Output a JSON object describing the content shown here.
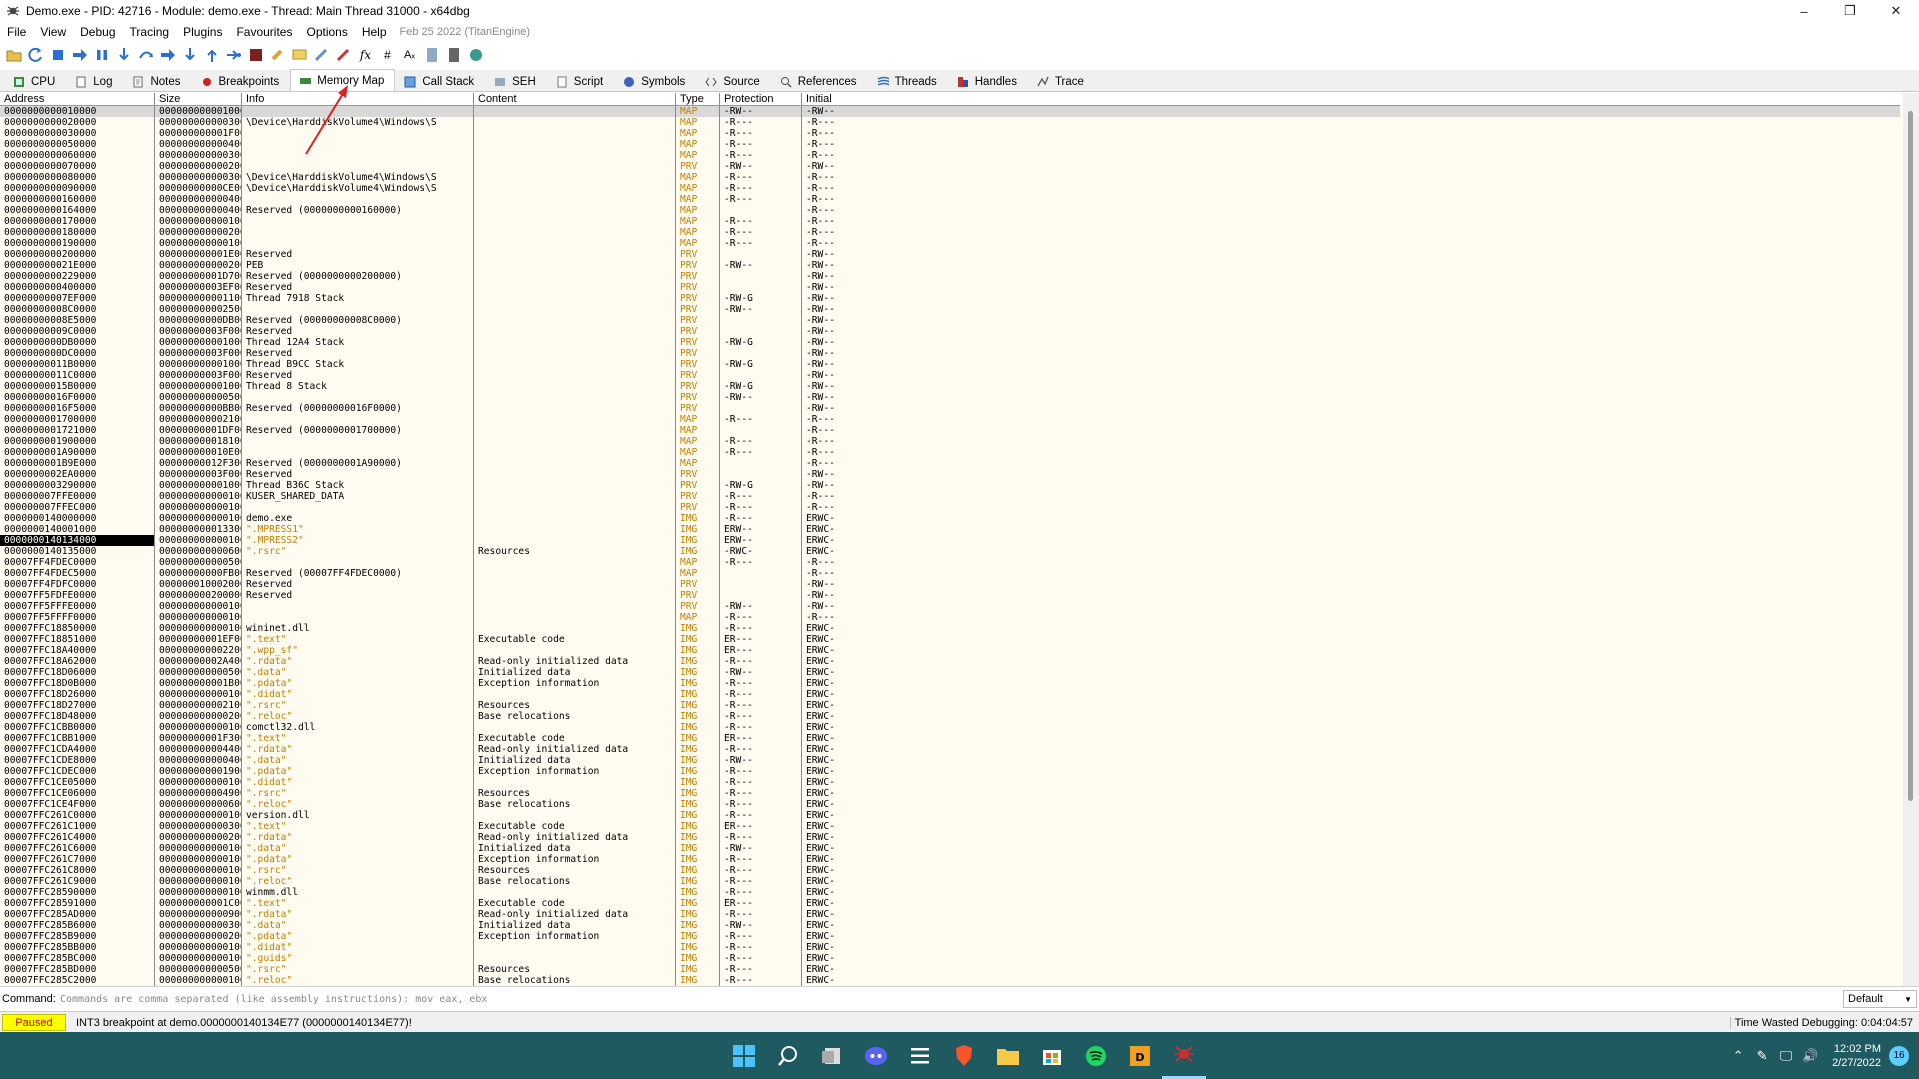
{
  "window": {
    "title": "Demo.exe - PID: 42716 - Module: demo.exe - Thread: Main Thread 31000 - x64dbg",
    "minimize_icon": "minimize-icon",
    "maximize_icon": "restore-icon",
    "close_icon": "close-icon"
  },
  "menu": {
    "items": [
      "File",
      "View",
      "Debug",
      "Tracing",
      "Plugins",
      "Favourites",
      "Options",
      "Help"
    ],
    "build": "Feb 25 2022 (TitanEngine)"
  },
  "tabs": [
    {
      "label": "CPU",
      "icon": "cpu-icon"
    },
    {
      "label": "Log",
      "icon": "log-icon"
    },
    {
      "label": "Notes",
      "icon": "notes-icon"
    },
    {
      "label": "Breakpoints",
      "icon": "breakpoint-icon"
    },
    {
      "label": "Memory Map",
      "icon": "memory-icon",
      "active": true
    },
    {
      "label": "Call Stack",
      "icon": "callstack-icon"
    },
    {
      "label": "SEH",
      "icon": "seh-icon"
    },
    {
      "label": "Script",
      "icon": "script-icon"
    },
    {
      "label": "Symbols",
      "icon": "symbols-icon"
    },
    {
      "label": "Source",
      "icon": "source-icon"
    },
    {
      "label": "References",
      "icon": "references-icon"
    },
    {
      "label": "Threads",
      "icon": "threads-icon"
    },
    {
      "label": "Handles",
      "icon": "handles-icon"
    },
    {
      "label": "Trace",
      "icon": "trace-icon"
    }
  ],
  "columns": [
    "Address",
    "Size",
    "Info",
    "Content",
    "Type",
    "Protection",
    "Initial"
  ],
  "rows": [
    [
      "0000000000010000",
      "0000000000010000",
      "",
      "",
      "MAP",
      "-RW--",
      "-RW--"
    ],
    [
      "0000000000020000",
      "0000000000003000",
      "\\Device\\HarddiskVolume4\\Windows\\S",
      "",
      "MAP",
      "-R---",
      "-R---"
    ],
    [
      "0000000000030000",
      "000000000001F000",
      "",
      "",
      "MAP",
      "-R---",
      "-R---"
    ],
    [
      "0000000000050000",
      "0000000000004000",
      "",
      "",
      "MAP",
      "-R---",
      "-R---"
    ],
    [
      "0000000000060000",
      "0000000000003000",
      "",
      "",
      "MAP",
      "-R---",
      "-R---"
    ],
    [
      "0000000000070000",
      "0000000000002000",
      "",
      "",
      "PRV",
      "-RW--",
      "-RW--"
    ],
    [
      "0000000000080000",
      "0000000000003000",
      "\\Device\\HarddiskVolume4\\Windows\\S",
      "",
      "MAP",
      "-R---",
      "-R---"
    ],
    [
      "0000000000090000",
      "00000000000CE000",
      "\\Device\\HarddiskVolume4\\Windows\\S",
      "",
      "MAP",
      "-R---",
      "-R---"
    ],
    [
      "0000000000160000",
      "0000000000004000",
      "",
      "",
      "MAP",
      "-R---",
      "-R---"
    ],
    [
      "0000000000164000",
      "0000000000004000",
      "Reserved (0000000000160000)",
      "",
      "MAP",
      "",
      "-R---"
    ],
    [
      "0000000000170000",
      "0000000000001000",
      "",
      "",
      "MAP",
      "-R---",
      "-R---"
    ],
    [
      "0000000000180000",
      "0000000000002000",
      "",
      "",
      "MAP",
      "-R---",
      "-R---"
    ],
    [
      "0000000000190000",
      "0000000000001000",
      "",
      "",
      "MAP",
      "-R---",
      "-R---"
    ],
    [
      "0000000000200000",
      "000000000001E000",
      "Reserved",
      "",
      "PRV",
      "",
      "-RW--"
    ],
    [
      "000000000021E000",
      "0000000000002000",
      "PEB",
      "",
      "PRV",
      "-RW--",
      "-RW--"
    ],
    [
      "0000000000229000",
      "00000000001D7000",
      "Reserved (0000000000200000)",
      "",
      "PRV",
      "",
      "-RW--"
    ],
    [
      "0000000000400000",
      "00000000003EF000",
      "Reserved",
      "",
      "PRV",
      "",
      "-RW--"
    ],
    [
      "00000000007EF000",
      "0000000000011000",
      "Thread 7918 Stack",
      "",
      "PRV",
      "-RW-G",
      "-RW--"
    ],
    [
      "00000000008C0000",
      "0000000000025000",
      "",
      "",
      "PRV",
      "-RW--",
      "-RW--"
    ],
    [
      "00000000008E5000",
      "00000000000DB000",
      "Reserved (00000000008C0000)",
      "",
      "PRV",
      "",
      "-RW--"
    ],
    [
      "00000000009C0000",
      "00000000003F0000",
      "Reserved",
      "",
      "PRV",
      "",
      "-RW--"
    ],
    [
      "0000000000DB0000",
      "0000000000010000",
      "Thread 12A4 Stack",
      "",
      "PRV",
      "-RW-G",
      "-RW--"
    ],
    [
      "0000000000DC0000",
      "00000000003F0000",
      "Reserved",
      "",
      "PRV",
      "",
      "-RW--"
    ],
    [
      "00000000011B0000",
      "0000000000010000",
      "Thread B9CC Stack",
      "",
      "PRV",
      "-RW-G",
      "-RW--"
    ],
    [
      "00000000011C0000",
      "00000000003F0000",
      "Reserved",
      "",
      "PRV",
      "",
      "-RW--"
    ],
    [
      "00000000015B0000",
      "0000000000010000",
      "Thread 8 Stack",
      "",
      "PRV",
      "-RW-G",
      "-RW--"
    ],
    [
      "00000000016F0000",
      "0000000000005000",
      "",
      "",
      "PRV",
      "-RW--",
      "-RW--"
    ],
    [
      "00000000016F5000",
      "00000000000BB000",
      "Reserved (00000000016F0000)",
      "",
      "PRV",
      "",
      "-RW--"
    ],
    [
      "0000000001700000",
      "0000000000021000",
      "",
      "",
      "MAP",
      "-R---",
      "-R---"
    ],
    [
      "0000000001721000",
      "00000000001DF000",
      "Reserved (0000000001700000)",
      "",
      "MAP",
      "",
      "-R---"
    ],
    [
      "0000000001900000",
      "0000000000181000",
      "",
      "",
      "MAP",
      "-R---",
      "-R---"
    ],
    [
      "0000000001A90000",
      "000000000010E000",
      "",
      "",
      "MAP",
      "-R---",
      "-R---"
    ],
    [
      "0000000001B9E000",
      "00000000012F3000",
      "Reserved (0000000001A90000)",
      "",
      "MAP",
      "",
      "-R---"
    ],
    [
      "0000000002EA0000",
      "00000000003F0000",
      "Reserved",
      "",
      "PRV",
      "",
      "-RW--"
    ],
    [
      "0000000003290000",
      "0000000000010000",
      "Thread B36C Stack",
      "",
      "PRV",
      "-RW-G",
      "-RW--"
    ],
    [
      "000000007FFE0000",
      "0000000000001000",
      "KUSER_SHARED_DATA",
      "",
      "PRV",
      "-R---",
      "-R---"
    ],
    [
      "000000007FFEC000",
      "0000000000001000",
      "",
      "",
      "PRV",
      "-R---",
      "-R---"
    ],
    [
      "0000000140000000",
      "0000000000001000",
      "demo.exe",
      "",
      "IMG",
      "-R---",
      "ERWC-"
    ],
    [
      "0000000140001000",
      "0000000000133000",
      "\".MPRESS1\"",
      "",
      "IMG",
      "ERW--",
      "ERWC-"
    ],
    [
      "0000000140134000",
      "0000000000001000",
      "\".MPRESS2\"",
      "",
      "IMG",
      "ERW--",
      "ERWC-"
    ],
    [
      "0000000140135000",
      "0000000000006000",
      "\".rsrc\"",
      "Resources",
      "IMG",
      "-RWC-",
      "ERWC-"
    ],
    [
      "00007FF4FDEC0000",
      "0000000000005000",
      "",
      "",
      "MAP",
      "-R---",
      "-R---"
    ],
    [
      "00007FF4FDEC5000",
      "00000000000FB000",
      "Reserved (00007FF4FDEC0000)",
      "",
      "MAP",
      "",
      "-R---"
    ],
    [
      "00007FF4FDFC0000",
      "0000000100020000",
      "Reserved",
      "",
      "PRV",
      "",
      "-RW--"
    ],
    [
      "00007FF5FDFE0000",
      "0000000002000000",
      "Reserved",
      "",
      "PRV",
      "",
      "-RW--"
    ],
    [
      "00007FF5FFFE0000",
      "0000000000001000",
      "",
      "",
      "PRV",
      "-RW--",
      "-RW--"
    ],
    [
      "00007FF5FFFF0000",
      "0000000000001000",
      "",
      "",
      "MAP",
      "-R---",
      "-R---"
    ],
    [
      "00007FFC18850000",
      "0000000000001000",
      "wininet.dll",
      "",
      "IMG",
      "-R---",
      "ERWC-"
    ],
    [
      "00007FFC18851000",
      "00000000001EF000",
      "\".text\"",
      "Executable code",
      "IMG",
      "ER---",
      "ERWC-"
    ],
    [
      "00007FFC18A40000",
      "0000000000022000",
      "\".wpp_sf\"",
      "",
      "IMG",
      "ER---",
      "ERWC-"
    ],
    [
      "00007FFC18A62000",
      "00000000002A4000",
      "\".rdata\"",
      "Read-only initialized data",
      "IMG",
      "-R---",
      "ERWC-"
    ],
    [
      "00007FFC18D06000",
      "0000000000005000",
      "\".data\"",
      "Initialized data",
      "IMG",
      "-RW--",
      "ERWC-"
    ],
    [
      "00007FFC18D0B000",
      "000000000001B000",
      "\".pdata\"",
      "Exception information",
      "IMG",
      "-R---",
      "ERWC-"
    ],
    [
      "00007FFC18D26000",
      "0000000000001000",
      "\".didat\"",
      "",
      "IMG",
      "-R---",
      "ERWC-"
    ],
    [
      "00007FFC18D27000",
      "0000000000021000",
      "\".rsrc\"",
      "Resources",
      "IMG",
      "-R---",
      "ERWC-"
    ],
    [
      "00007FFC18D48000",
      "0000000000002000",
      "\".reloc\"",
      "Base relocations",
      "IMG",
      "-R---",
      "ERWC-"
    ],
    [
      "00007FFC1CBB0000",
      "0000000000001000",
      "comctl32.dll",
      "",
      "IMG",
      "-R---",
      "ERWC-"
    ],
    [
      "00007FFC1CBB1000",
      "00000000001F3000",
      "\".text\"",
      "Executable code",
      "IMG",
      "ER---",
      "ERWC-"
    ],
    [
      "00007FFC1CDA4000",
      "0000000000044000",
      "\".rdata\"",
      "Read-only initialized data",
      "IMG",
      "-R---",
      "ERWC-"
    ],
    [
      "00007FFC1CDE8000",
      "0000000000004000",
      "\".data\"",
      "Initialized data",
      "IMG",
      "-RW--",
      "ERWC-"
    ],
    [
      "00007FFC1CDEC000",
      "0000000000019000",
      "\".pdata\"",
      "Exception information",
      "IMG",
      "-R---",
      "ERWC-"
    ],
    [
      "00007FFC1CE05000",
      "0000000000001000",
      "\".didat\"",
      "",
      "IMG",
      "-R---",
      "ERWC-"
    ],
    [
      "00007FFC1CE06000",
      "0000000000049000",
      "\".rsrc\"",
      "Resources",
      "IMG",
      "-R---",
      "ERWC-"
    ],
    [
      "00007FFC1CE4F000",
      "0000000000006000",
      "\".reloc\"",
      "Base relocations",
      "IMG",
      "-R---",
      "ERWC-"
    ],
    [
      "00007FFC261C0000",
      "0000000000001000",
      "version.dll",
      "",
      "IMG",
      "-R---",
      "ERWC-"
    ],
    [
      "00007FFC261C1000",
      "0000000000003000",
      "\".text\"",
      "Executable code",
      "IMG",
      "ER---",
      "ERWC-"
    ],
    [
      "00007FFC261C4000",
      "0000000000002000",
      "\".rdata\"",
      "Read-only initialized data",
      "IMG",
      "-R---",
      "ERWC-"
    ],
    [
      "00007FFC261C6000",
      "0000000000001000",
      "\".data\"",
      "Initialized data",
      "IMG",
      "-RW--",
      "ERWC-"
    ],
    [
      "00007FFC261C7000",
      "0000000000001000",
      "\".pdata\"",
      "Exception information",
      "IMG",
      "-R---",
      "ERWC-"
    ],
    [
      "00007FFC261C8000",
      "0000000000001000",
      "\".rsrc\"",
      "Resources",
      "IMG",
      "-R---",
      "ERWC-"
    ],
    [
      "00007FFC261C9000",
      "0000000000001000",
      "\".reloc\"",
      "Base relocations",
      "IMG",
      "-R---",
      "ERWC-"
    ],
    [
      "00007FFC28590000",
      "0000000000001000",
      "winmm.dll",
      "",
      "IMG",
      "-R---",
      "ERWC-"
    ],
    [
      "00007FFC28591000",
      "000000000001C000",
      "\".text\"",
      "Executable code",
      "IMG",
      "ER---",
      "ERWC-"
    ],
    [
      "00007FFC285AD000",
      "0000000000009000",
      "\".rdata\"",
      "Read-only initialized data",
      "IMG",
      "-R---",
      "ERWC-"
    ],
    [
      "00007FFC285B6000",
      "0000000000003000",
      "\".data\"",
      "Initialized data",
      "IMG",
      "-RW--",
      "ERWC-"
    ],
    [
      "00007FFC285B9000",
      "0000000000002000",
      "\".pdata\"",
      "Exception information",
      "IMG",
      "-R---",
      "ERWC-"
    ],
    [
      "00007FFC285BB000",
      "0000000000001000",
      "\".didat\"",
      "",
      "IMG",
      "-R---",
      "ERWC-"
    ],
    [
      "00007FFC285BC000",
      "0000000000001000",
      "\".guids\"",
      "",
      "IMG",
      "-R---",
      "ERWC-"
    ],
    [
      "00007FFC285BD000",
      "0000000000005000",
      "\".rsrc\"",
      "Resources",
      "IMG",
      "-R---",
      "ERWC-"
    ],
    [
      "00007FFC285C2000",
      "0000000000001000",
      "\".reloc\"",
      "Base relocations",
      "IMG",
      "-R---",
      "ERWC-"
    ]
  ],
  "selected_address": "0000000140134000",
  "command": {
    "label": "Command:",
    "placeholder": "Commands are comma separated (like assembly instructions): mov eax, ebx",
    "engine": "Default"
  },
  "status": {
    "state": "Paused",
    "message": "INT3 breakpoint at demo.0000000140134E77 (0000000140134E77)!",
    "timer": "Time Wasted Debugging: 0:04:04:57"
  },
  "taskbar": {
    "time": "12:02 PM",
    "date": "2/27/2022",
    "notifications": "16",
    "apps": [
      "start-icon",
      "search-icon",
      "task-view-icon",
      "discord-icon",
      "xeditor-icon",
      "brave-icon",
      "file-explorer-icon",
      "store-icon",
      "spotify-icon",
      "dotnet-icon",
      "x64dbg-icon"
    ]
  },
  "colors": {
    "taskbar": "#1f5a60",
    "paused_bg": "#ffff00",
    "paused_fg": "#c00000",
    "grid_bg": "#fffbf0",
    "type_fg": "#c08000"
  }
}
